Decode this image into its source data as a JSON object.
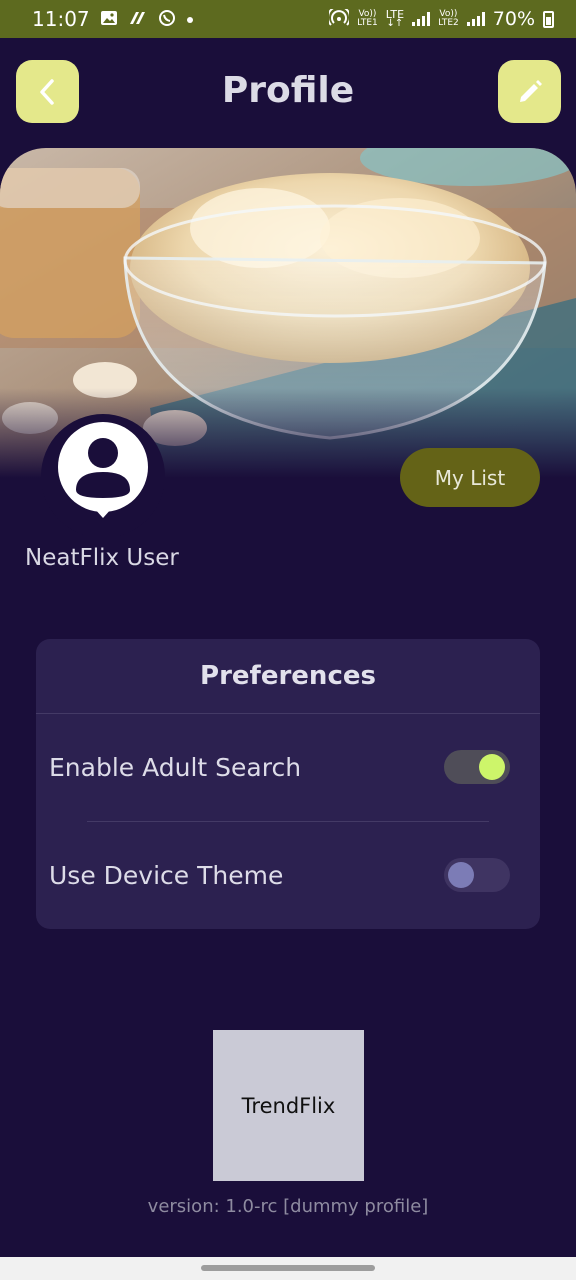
{
  "status_bar": {
    "time": "11:07",
    "net1_top": "Vo))",
    "net1_bottom": "LTE1",
    "net_lte": "LTE",
    "net2_top": "Vo))",
    "net2_bottom": "LTE2",
    "battery": "70%"
  },
  "header": {
    "title": "Profile"
  },
  "profile": {
    "user_name": "NeatFlix User",
    "my_list_label": "My List"
  },
  "preferences": {
    "title": "Preferences",
    "items": [
      {
        "label": "Enable Adult Search",
        "enabled": true
      },
      {
        "label": "Use Device Theme",
        "enabled": false
      }
    ]
  },
  "footer": {
    "logo_text": "TrendFlix",
    "version": "version: 1.0-rc [dummy profile]"
  },
  "colors": {
    "background": "#1a0e3a",
    "accent_button": "#e4e88b",
    "my_list_button": "#646317",
    "card": "#2c2150",
    "toggle_on": "#cdf56a"
  }
}
